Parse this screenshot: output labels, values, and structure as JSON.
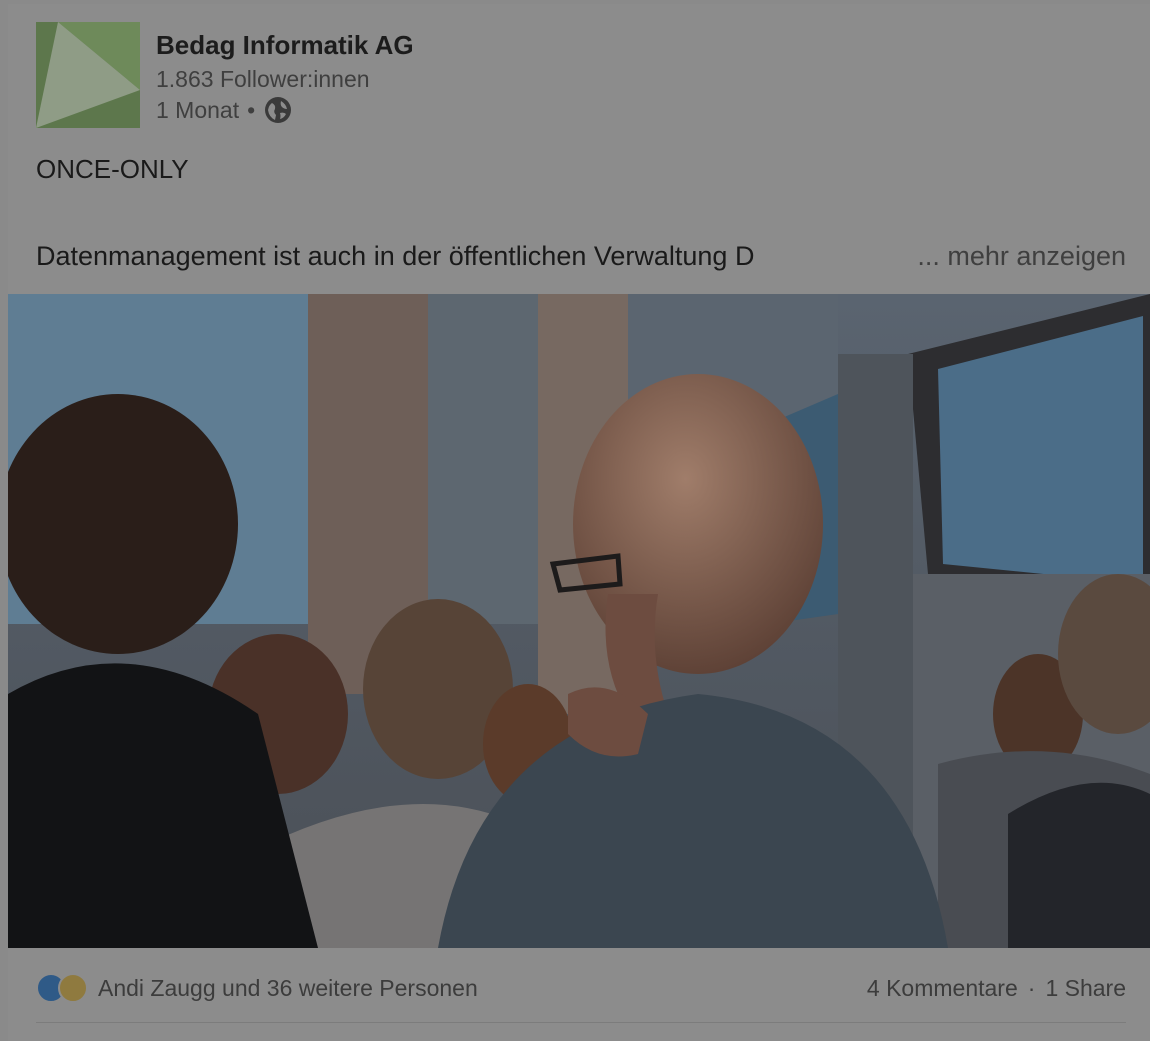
{
  "post": {
    "company_name": "Bedag Informatik AG",
    "followers": "1.863 Follower:innen",
    "time": "1 Monat",
    "separator": "•",
    "visibility_icon": "globe-icon",
    "title": "ONCE-ONLY",
    "body_excerpt": "Datenmanagement ist auch in der öffentlichen Verwaltung D",
    "more_label": "... mehr anzeigen"
  },
  "social": {
    "reaction_icons": [
      "clap-icon",
      "lightbulb-icon"
    ],
    "reactors_text": "Andi Zaugg und 36 weitere Personen",
    "comments": "4 Kommentare",
    "dot": "·",
    "shares": "1 Share"
  },
  "colors": {
    "logo_green": "#5d774c",
    "overlay_gray": "#8c8c8c"
  }
}
